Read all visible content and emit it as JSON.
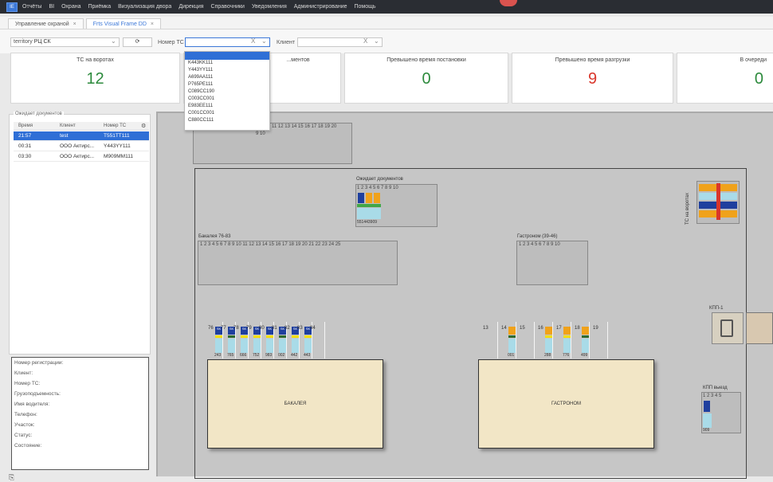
{
  "menu": {
    "logo": "IE",
    "items": [
      "Отчёты",
      "BI",
      "Охрана",
      "Приёмка",
      "Визуализация двора",
      "Дирекция",
      "Справочники",
      "Уведомления",
      "Администрирование",
      "Помощь"
    ]
  },
  "tabs": [
    {
      "label": "Управление охраной",
      "close": "×"
    },
    {
      "label": "Frts Visual Frame DD",
      "close": "×",
      "active": true
    }
  ],
  "filters": {
    "territory_label": "territory",
    "territory_value": "РЦ СК",
    "truck_label": "Номер ТС",
    "truck_value": "",
    "client_label": "Клиент",
    "client_value": "",
    "clear": "X",
    "caret": "⌄",
    "refresh": "⟳"
  },
  "cards": [
    {
      "title": "ТС на воротах",
      "value": "12",
      "color": "#2c8a3c"
    },
    {
      "title": "...ментов",
      "value": "",
      "color": "#2c8a3c"
    },
    {
      "title": "Превышено время постановки",
      "value": "0",
      "color": "#2c8a3c"
    },
    {
      "title": "Превышено время разгрузки",
      "value": "9",
      "color": "#d9362b"
    },
    {
      "title": "В очереди",
      "value": "0",
      "color": "#2c8a3c"
    }
  ],
  "dropdown": {
    "options": [
      "K443KK111",
      "Y443YY111",
      "A699AA111",
      "P765PE111",
      "C089CC190",
      "C003CC001",
      "E983EE111",
      "C001CC001",
      "C880CC111"
    ]
  },
  "waiting": {
    "legend": "Ожидает документов",
    "headers": [
      "Время",
      "Клиент",
      "Номер ТС"
    ],
    "rows": [
      {
        "time": "21:57",
        "client": "test",
        "plate": "T551TT111",
        "selected": true
      },
      {
        "time": "00:31",
        "client": "ООО Актирс...",
        "plate": "Y443YY111",
        "selected": false
      },
      {
        "time": "03:30",
        "client": "ООО Актирс...",
        "plate": "M909MM111",
        "selected": false
      }
    ]
  },
  "info": {
    "lines": [
      "Номер регистрации:",
      "Клиент:",
      "Номер ТС:",
      "Грузоподъемность:",
      "Имя водителя:",
      "Телефон:",
      "Участок:",
      "Статус:",
      "Состояние:"
    ]
  },
  "map": {
    "top_dock_numbers": "11 12 13 14 15 16 17 18 19 20",
    "top_dock_sub": "9 10",
    "waiting_zone": {
      "label": "Ожидает документов",
      "numbers": "1 2 3 4 5 6 7 8 9 10",
      "plate": "551443909"
    },
    "bakaleya_dock": {
      "label": "Бакалея 76-83",
      "numbers": "1 2 3 4 5 6 7 8 9 10 11 12 13 14 15 16 17 18 19 20 21 22 23 24 25"
    },
    "gastronom_dock": {
      "label": "Гастроном (39-46)",
      "numbers": "1 2 3 4 5 6 7 8 9 10"
    },
    "vertical_label": "ТС на воротах",
    "kpp1": "КПП-1",
    "kpp_exit": {
      "label": "КПП выезд",
      "numbers": "1 2 3 4 5",
      "plate": "909"
    },
    "building_bakaleya": "БАКАЛЕЯ",
    "building_gastronom": "ГАСТРОНОМ",
    "gates_left": [
      {
        "n": "76",
        "num": "243"
      },
      {
        "n": "77",
        "num": "765"
      },
      {
        "n": "78",
        "num": "666"
      },
      {
        "n": "79",
        "num": "752"
      },
      {
        "n": "80",
        "num": "983"
      },
      {
        "n": "81",
        "num": "002"
      },
      {
        "n": "82",
        "num": "442"
      },
      {
        "n": "83",
        "num": "443"
      },
      {
        "n": "84",
        "num": ""
      }
    ],
    "gates_right": [
      {
        "n": "13",
        "num": ""
      },
      {
        "n": "14",
        "num": "001"
      },
      {
        "n": "15",
        "num": ""
      },
      {
        "n": "16",
        "num": "288"
      },
      {
        "n": "17",
        "num": "776"
      },
      {
        "n": "18",
        "num": "499"
      },
      {
        "n": "19",
        "num": ""
      }
    ],
    "truck_tag": "SK"
  },
  "footer_icon": "⎘"
}
